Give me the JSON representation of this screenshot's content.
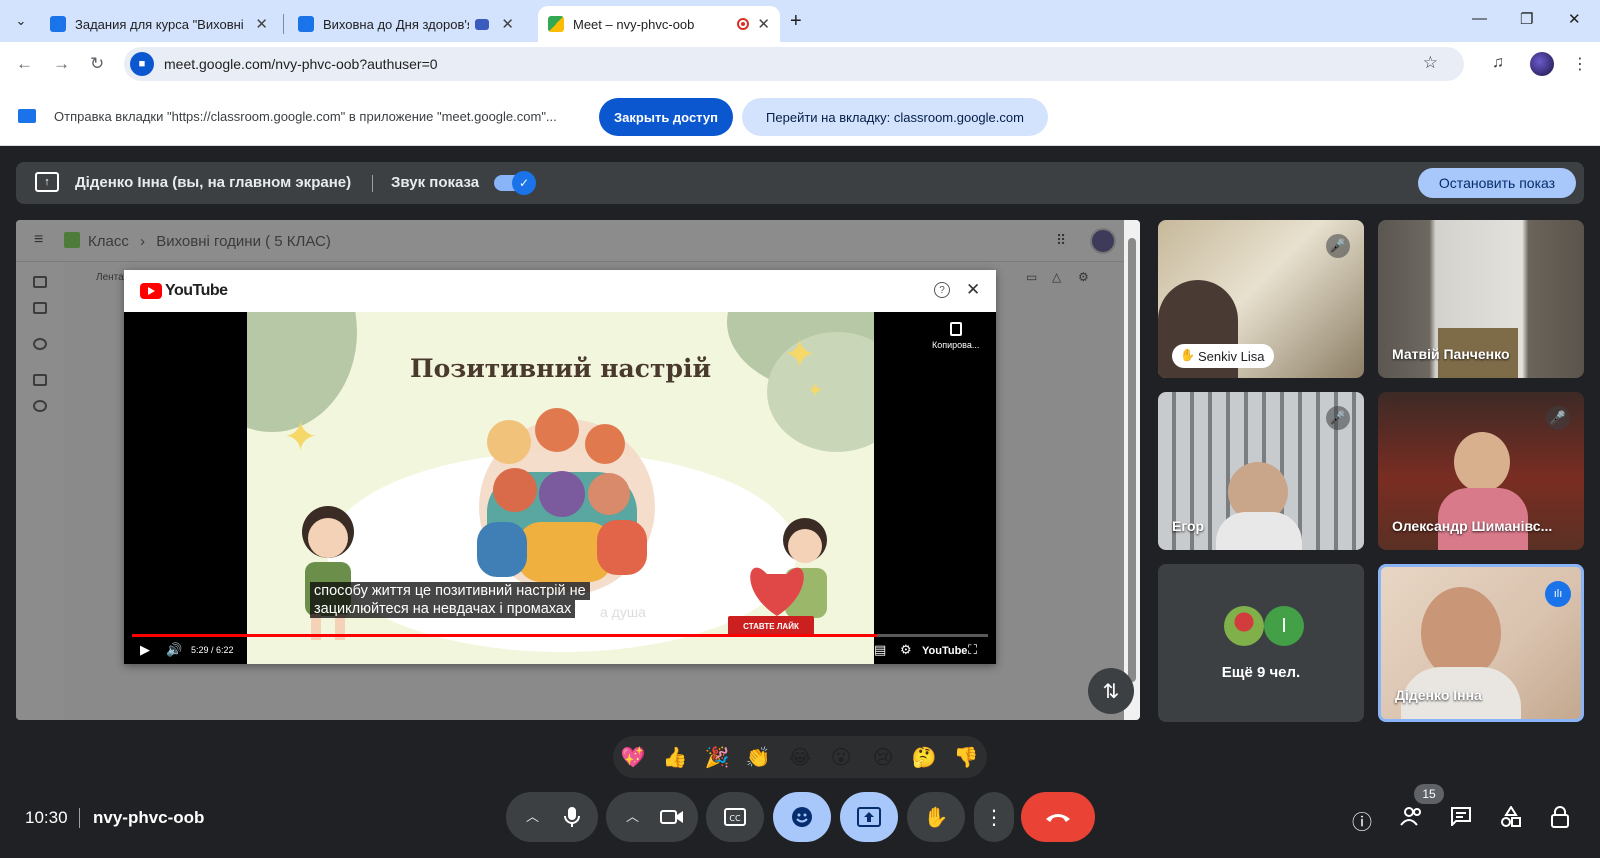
{
  "browser": {
    "tabs": [
      {
        "label": "Задания для курса \"Виховні го",
        "close": "✕"
      },
      {
        "label": "Виховна до Дня здоров'я.",
        "close": "✕"
      },
      {
        "label": "Meet – nvy-phvc-oob",
        "close": "✕"
      }
    ],
    "new_tab": "+",
    "window_controls": {
      "minimize": "—",
      "restore": "❐",
      "close": "✕"
    },
    "url": "meet.google.com/nvy-phvc-oob?authuser=0"
  },
  "infobar": {
    "text": "Отправка вкладки \"https://classroom.google.com\" в приложение \"meet.google.com\"...",
    "stop_access": "Закрыть доступ",
    "go_to_tab": "Перейти на вкладку: classroom.google.com"
  },
  "presenting": {
    "presenter": "Діденко Інна (вы, на главном экране)",
    "sound_label": "Звук показа",
    "sound_on": true,
    "stop_button": "Остановить показ"
  },
  "classroom": {
    "crumb_root": "Класс",
    "crumb_sep": "›",
    "crumb_course": "Виховні години ( 5 КЛАС)",
    "tab_lenta": "Лента"
  },
  "youtube": {
    "logo_text": "YouTube",
    "slide_title": "Позитивний настрій",
    "copy_label": "Копирова...",
    "caption_line1": "способу життя це позитивний настрій не",
    "caption_line2": "зациклюйтеся на невдачах і промахах",
    "behind_text": "а душа",
    "subscribe": "СТАВТЕ ЛАЙК",
    "time": "5:29 / 6:22",
    "progress": 0.87,
    "brand": "YouTube"
  },
  "participants": [
    {
      "name": "Senkiv Lisa",
      "muted": true
    },
    {
      "name": "Матвій Панченко",
      "muted": false
    },
    {
      "name": "Егор",
      "muted": true
    },
    {
      "name": "Олександр Шиманівс...",
      "muted": true
    },
    {
      "name": "Ещё 9 чел.",
      "initial": "I"
    },
    {
      "name": "Діденко Інна",
      "speaking": true
    }
  ],
  "reactions": [
    "💖",
    "👍",
    "🎉",
    "👏",
    "😂",
    "😮",
    "😢",
    "🤔",
    "👎"
  ],
  "bottom_bar": {
    "time": "10:30",
    "meeting_code": "nvy-phvc-oob",
    "participant_count": "15"
  },
  "colors": {
    "meet_bg": "#202124",
    "accent_blue": "#1a73e8",
    "end_call_red": "#ea4335",
    "tab_strip": "#d3e3fd"
  }
}
